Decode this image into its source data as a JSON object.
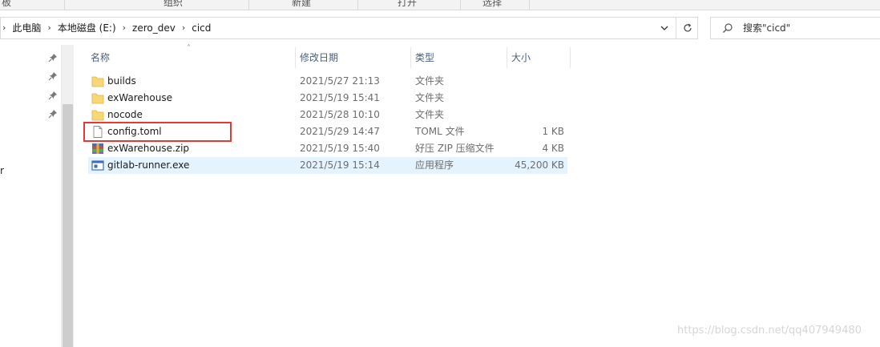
{
  "ribbon": {
    "groups": [
      "板",
      "组织",
      "新建",
      "打开",
      "选择"
    ]
  },
  "address_bar": {
    "breadcrumbs": [
      "此电脑",
      "本地磁盘 (E:)",
      "zero_dev",
      "cicd"
    ],
    "dropdown_icon": "chevron-down-icon",
    "refresh_icon": "refresh-icon"
  },
  "search": {
    "placeholder": "搜索\"cicd\"",
    "icon": "search-icon"
  },
  "nav_pane": {
    "pinned_count": 4,
    "fragment_text": "r"
  },
  "columns": {
    "name": "名称",
    "date": "修改日期",
    "type": "类型",
    "size": "大小"
  },
  "files": [
    {
      "name": "builds",
      "date": "2021/5/27 21:13",
      "type": "文件夹",
      "size": "",
      "icon": "folder-icon"
    },
    {
      "name": "exWarehouse",
      "date": "2021/5/19 15:41",
      "type": "文件夹",
      "size": "",
      "icon": "folder-icon"
    },
    {
      "name": "nocode",
      "date": "2021/5/28 10:10",
      "type": "文件夹",
      "size": "",
      "icon": "folder-icon"
    },
    {
      "name": "config.toml",
      "date": "2021/5/29 14:47",
      "type": "TOML 文件",
      "size": "1 KB",
      "icon": "file-icon"
    },
    {
      "name": "exWarehouse.zip",
      "date": "2021/5/19 15:40",
      "type": "好压 ZIP 压缩文件",
      "size": "4 KB",
      "icon": "zip-archive-icon"
    },
    {
      "name": "gitlab-runner.exe",
      "date": "2021/5/19 15:14",
      "type": "应用程序",
      "size": "45,200 KB",
      "icon": "exe-app-icon"
    }
  ],
  "selected_file": "gitlab-runner.exe",
  "highlighted_file": "config.toml",
  "colors": {
    "highlight_border": "#e53935",
    "selection_bg": "#e5f3ff",
    "folder": "#f8d775",
    "header_text": "#4c607a"
  },
  "watermark": "https://blog.csdn.net/qq407949480"
}
